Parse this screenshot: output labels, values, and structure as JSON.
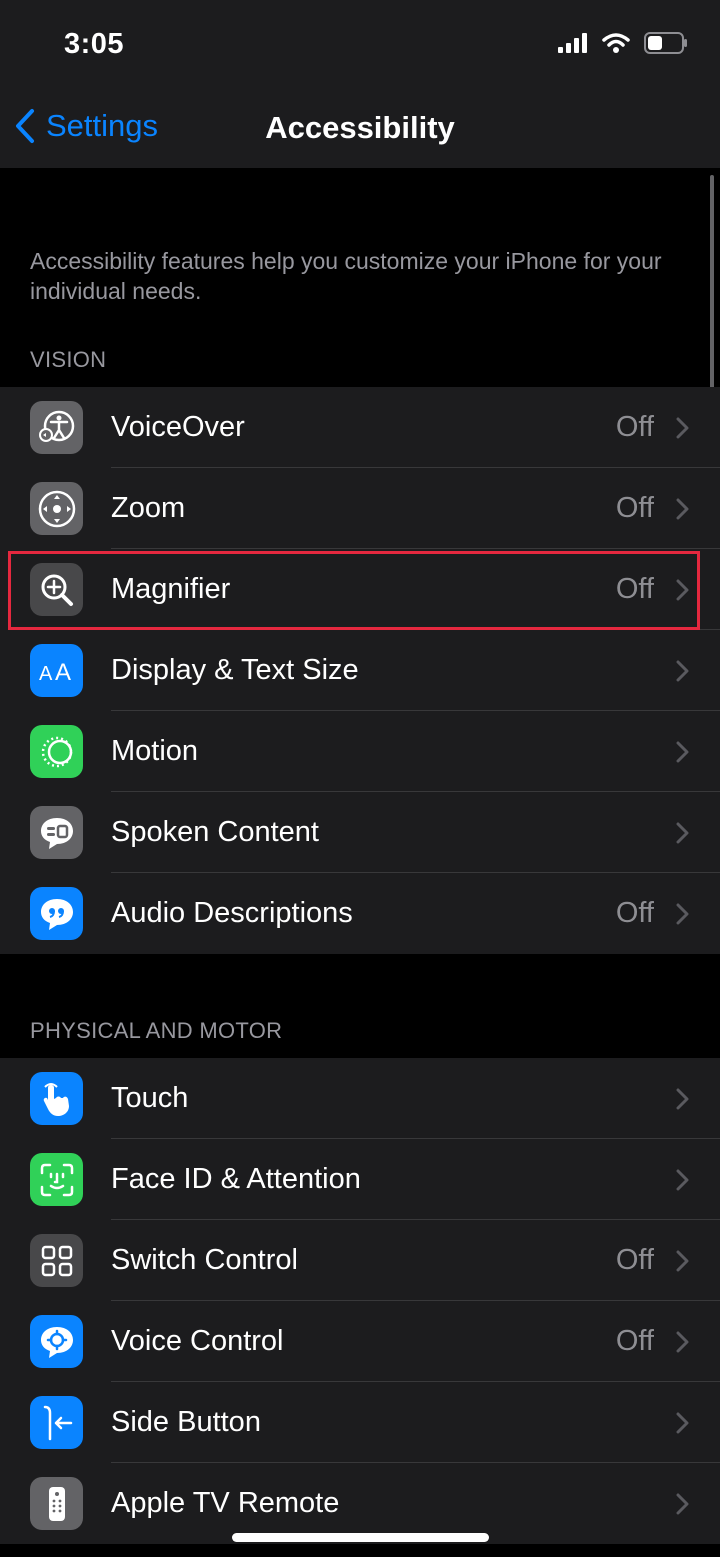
{
  "status_bar": {
    "time": "3:05"
  },
  "nav": {
    "back_label": "Settings",
    "title": "Accessibility"
  },
  "intro_text": "Accessibility features help you customize your iPhone for your individual needs.",
  "sections": [
    {
      "header": "VISION",
      "items": [
        {
          "label": "VoiceOver",
          "value": "Off",
          "icon": "voiceover-icon",
          "icon_color": "#636366"
        },
        {
          "label": "Zoom",
          "value": "Off",
          "icon": "zoom-icon",
          "icon_color": "#636366"
        },
        {
          "label": "Magnifier",
          "value": "Off",
          "icon": "magnifier-icon",
          "icon_color": "#48484a",
          "highlighted": true
        },
        {
          "label": "Display & Text Size",
          "value": "",
          "icon": "text-size-icon",
          "icon_color": "#0a84ff"
        },
        {
          "label": "Motion",
          "value": "",
          "icon": "motion-icon",
          "icon_color": "#30d158"
        },
        {
          "label": "Spoken Content",
          "value": "",
          "icon": "spoken-content-icon",
          "icon_color": "#636366"
        },
        {
          "label": "Audio Descriptions",
          "value": "Off",
          "icon": "audio-descriptions-icon",
          "icon_color": "#0a84ff"
        }
      ]
    },
    {
      "header": "PHYSICAL AND MOTOR",
      "items": [
        {
          "label": "Touch",
          "value": "",
          "icon": "touch-icon",
          "icon_color": "#0a84ff"
        },
        {
          "label": "Face ID & Attention",
          "value": "",
          "icon": "face-id-icon",
          "icon_color": "#30d158"
        },
        {
          "label": "Switch Control",
          "value": "Off",
          "icon": "switch-control-icon",
          "icon_color": "#48484a"
        },
        {
          "label": "Voice Control",
          "value": "Off",
          "icon": "voice-control-icon",
          "icon_color": "#0a84ff"
        },
        {
          "label": "Side Button",
          "value": "",
          "icon": "side-button-icon",
          "icon_color": "#0a84ff"
        },
        {
          "label": "Apple TV Remote",
          "value": "",
          "icon": "remote-icon",
          "icon_color": "#636366"
        }
      ]
    }
  ],
  "colors": {
    "accent": "#0a84ff",
    "highlight_border": "#e5283f"
  }
}
